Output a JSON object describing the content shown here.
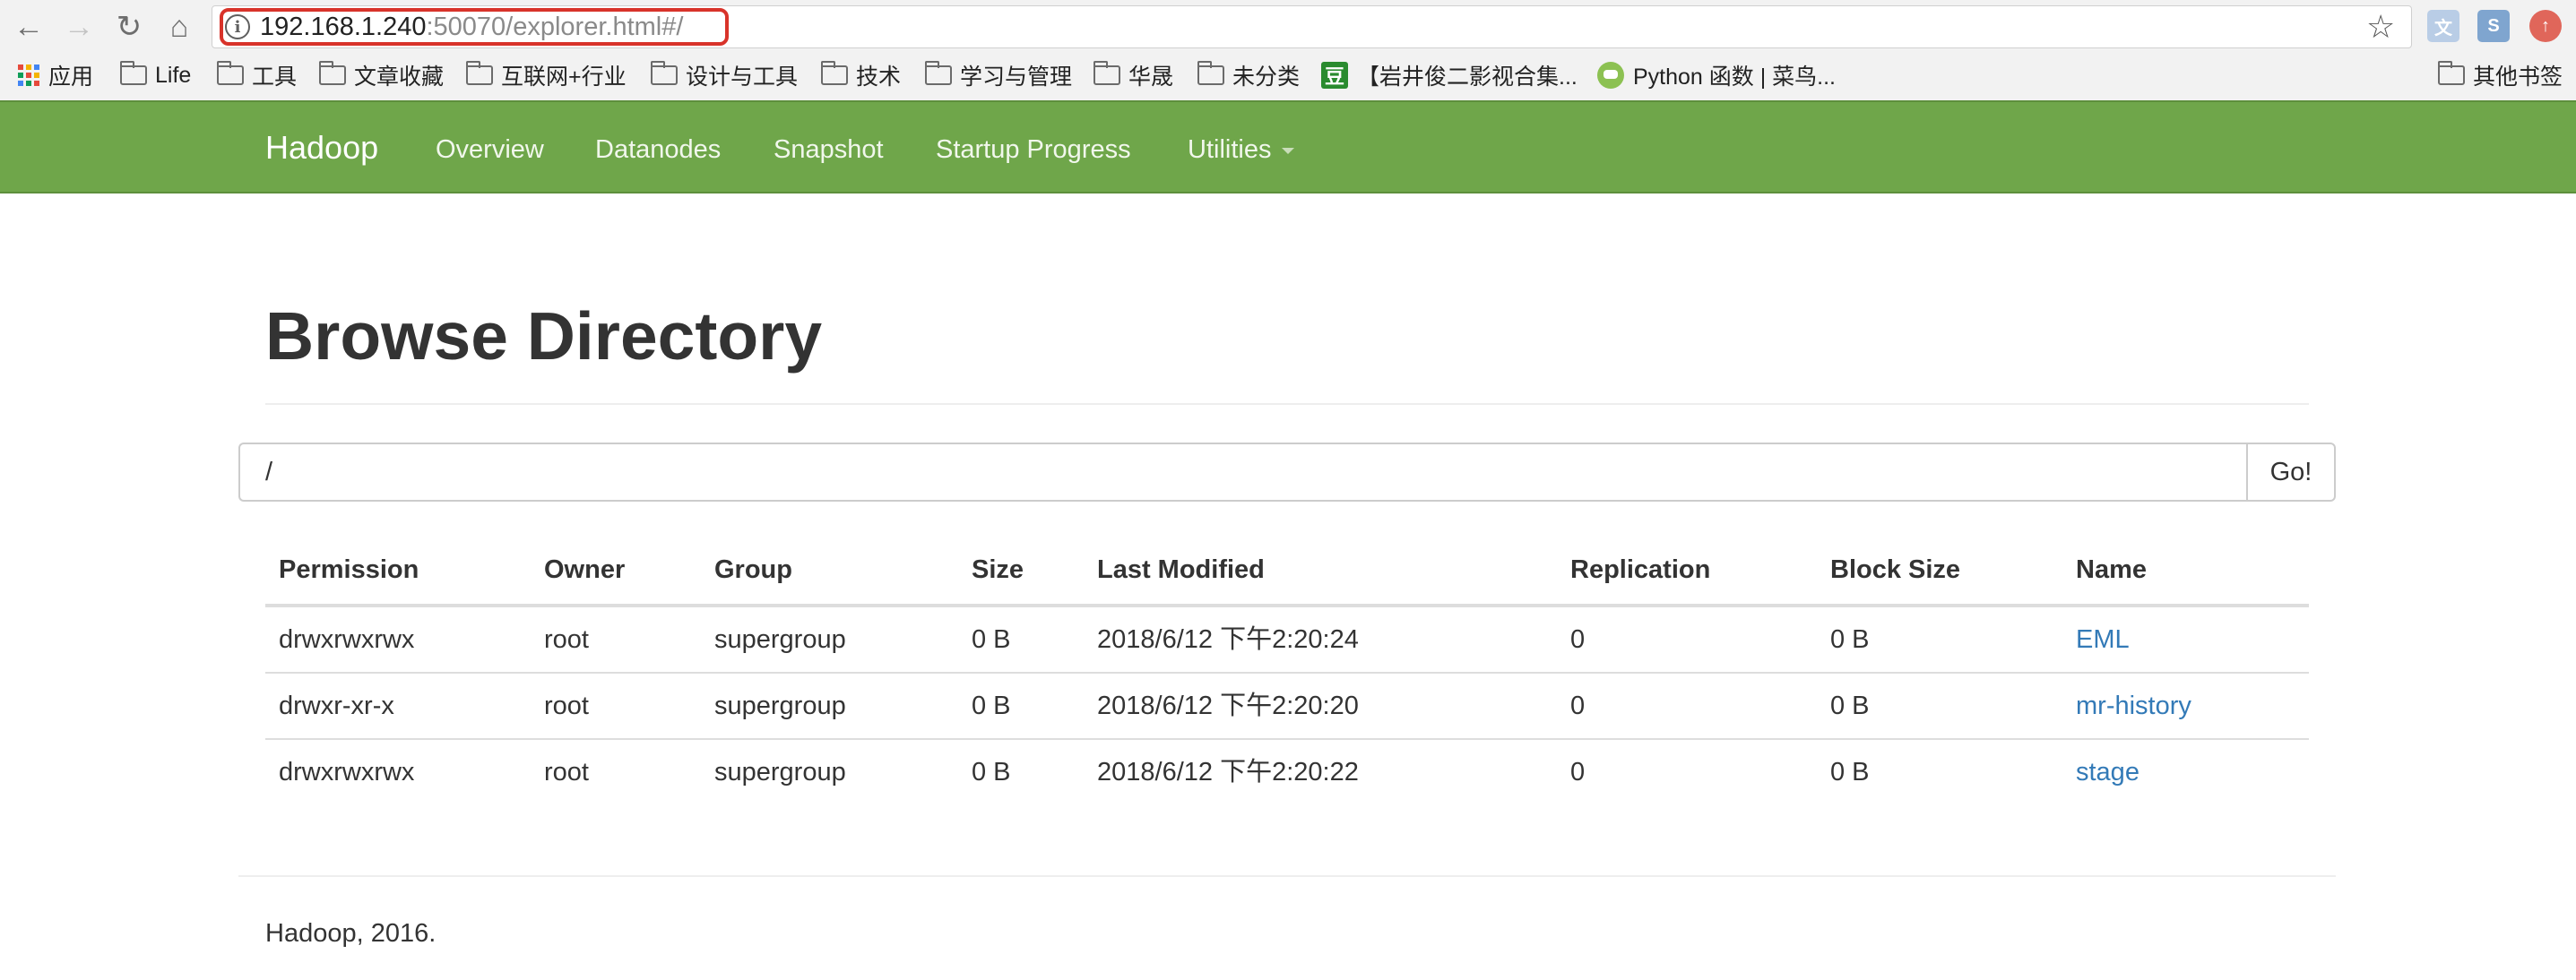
{
  "browser": {
    "url_host": "192.168.1.240",
    "url_rest": ":50070/explorer.html#/",
    "bookmarks": [
      {
        "label": "应用",
        "icon": "apps-grid-icon"
      },
      {
        "label": "Life",
        "icon": "folder-icon"
      },
      {
        "label": "工具",
        "icon": "folder-icon"
      },
      {
        "label": "文章收藏",
        "icon": "folder-icon"
      },
      {
        "label": "互联网+行业",
        "icon": "folder-icon"
      },
      {
        "label": "设计与工具",
        "icon": "folder-icon"
      },
      {
        "label": "技术",
        "icon": "folder-icon"
      },
      {
        "label": "学习与管理",
        "icon": "folder-icon"
      },
      {
        "label": "华晟",
        "icon": "folder-icon"
      },
      {
        "label": "未分类",
        "icon": "folder-icon"
      },
      {
        "label": "【岩井俊二影视合集...",
        "icon": "douban-icon"
      },
      {
        "label": "Python 函数 | 菜鸟...",
        "icon": "runoob-icon"
      }
    ],
    "other_bookmarks": "其他书签",
    "colors": {
      "url_highlight": "#d8332a"
    }
  },
  "navbar": {
    "brand": "Hadoop",
    "items": [
      "Overview",
      "Datanodes",
      "Snapshot",
      "Startup Progress",
      "Utilities"
    ],
    "color": "#6fa64a"
  },
  "page": {
    "title": "Browse Directory",
    "path_value": "/",
    "go_label": "Go!",
    "footer": "Hadoop, 2016."
  },
  "table": {
    "headers": [
      "Permission",
      "Owner",
      "Group",
      "Size",
      "Last Modified",
      "Replication",
      "Block Size",
      "Name"
    ],
    "rows": [
      [
        "drwxrwxrwx",
        "root",
        "supergroup",
        "0 B",
        "2018/6/12 下午2:20:24",
        "0",
        "0 B",
        "EML"
      ],
      [
        "drwxr-xr-x",
        "root",
        "supergroup",
        "0 B",
        "2018/6/12 下午2:20:20",
        "0",
        "0 B",
        "mr-history"
      ],
      [
        "drwxrwxrwx",
        "root",
        "supergroup",
        "0 B",
        "2018/6/12 下午2:20:22",
        "0",
        "0 B",
        "stage"
      ]
    ],
    "link_color": "#337ab7"
  }
}
